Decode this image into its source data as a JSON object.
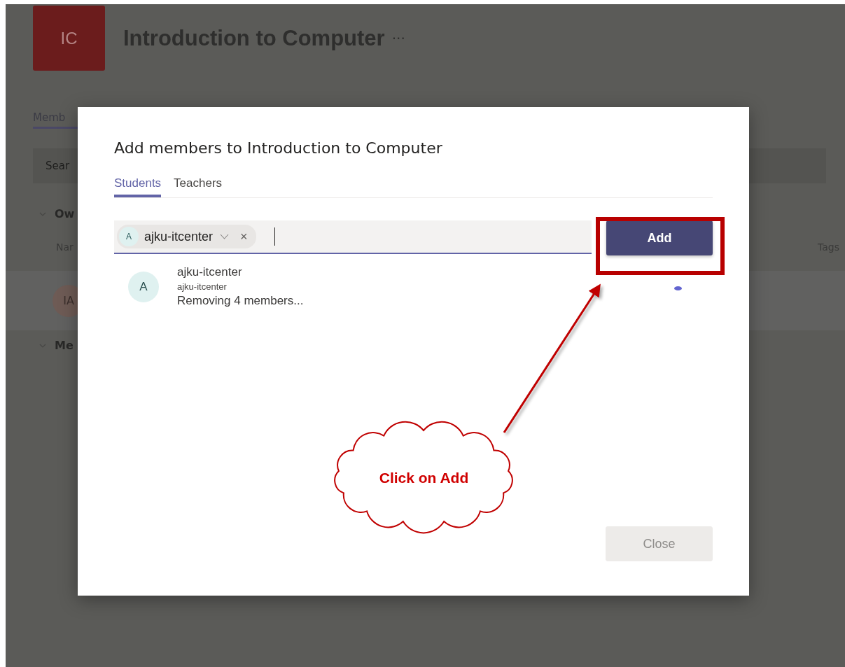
{
  "background": {
    "team_tile": "IC",
    "team_name": "Introduction to Computer",
    "more": "···",
    "tab": "Memb",
    "search": {
      "placeholder": "Sear"
    },
    "owners_section": "Ow",
    "name_column": "Nar",
    "tags_column": "Tags",
    "member_avatar": "IA",
    "members_section": "Me"
  },
  "dialog": {
    "title": "Add members to Introduction to Computer",
    "tabs": [
      {
        "label": "Students",
        "selected": true
      },
      {
        "label": "Teachers",
        "selected": false
      }
    ],
    "chip": {
      "avatar": "A",
      "name": "ajku-itcenter",
      "remove": "×"
    },
    "suggestion": {
      "avatar": "A",
      "name": "ajku-itcenter",
      "subtitle": "ajku-itcenter",
      "status": "Removing 4 members..."
    },
    "add_button": {
      "label": "Add"
    },
    "close_button": {
      "label": "Close",
      "disabled": true
    }
  },
  "annotation": {
    "callout": "Click on Add"
  }
}
